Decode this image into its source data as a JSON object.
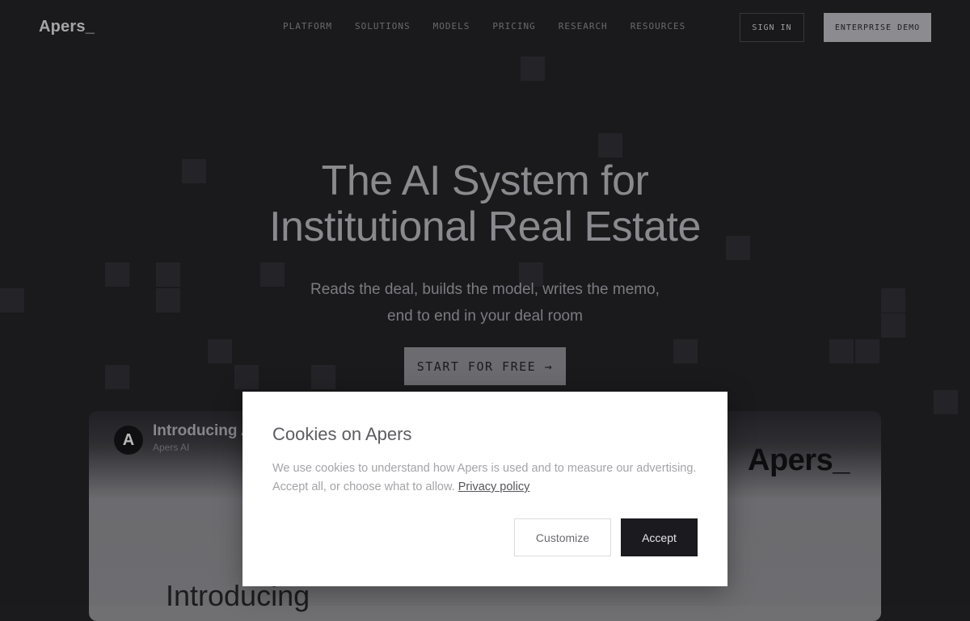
{
  "nav": {
    "logo": "Apers_",
    "links": [
      "PLATFORM",
      "SOLUTIONS",
      "MODELS",
      "PRICING",
      "RESEARCH",
      "RESOURCES"
    ],
    "sign_in": "SIGN IN",
    "demo": "ENTERPRISE DEMO"
  },
  "hero": {
    "title_line1": "The AI System for",
    "title_line2": "Institutional Real Estate",
    "subtitle_line1": "Reads the deal, builds the model, writes the memo,",
    "subtitle_line2": "end to end in your deal room",
    "cta": "START FOR FREE →"
  },
  "video": {
    "avatar_letter": "A",
    "title": "Introducing A",
    "channel": "Apers AI",
    "brand": "Apers_",
    "intro_text": "Introducing"
  },
  "cookie": {
    "title": "Cookies on Apers",
    "text": "We use cookies to understand how Apers is used and to measure our advertising. Accept all, or choose what to allow.",
    "link": "Privacy policy",
    "customize": "Customize",
    "accept": "Accept"
  },
  "colors": {
    "background": "#1b1a1d",
    "accent_button": "#8f8e93",
    "accept_button": "#1b1a1e"
  }
}
